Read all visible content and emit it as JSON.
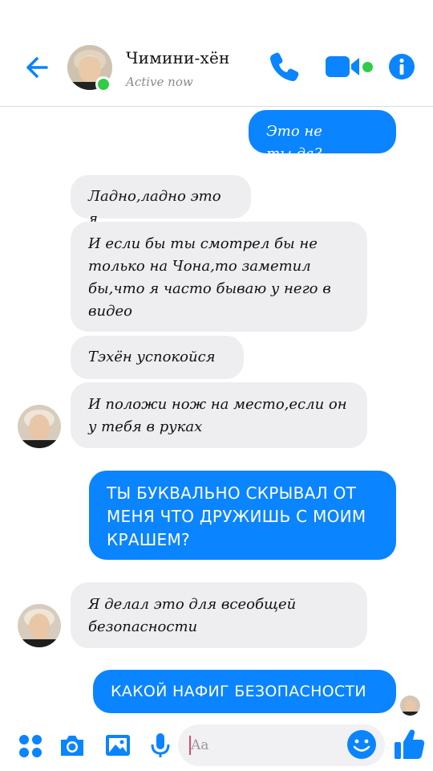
{
  "header": {
    "contact_name": "Чимини-хён",
    "status": "Active now"
  },
  "messages": [
    {
      "side": "out",
      "text": "Это не ты,да?"
    },
    {
      "side": "in",
      "text": "Ладно,ладно это я"
    },
    {
      "side": "in",
      "text": "И если бы ты смотрел бы не только на Чона,то заметил бы,что я часто бываю у него в видео"
    },
    {
      "side": "in",
      "text": "Тэхён успокойся"
    },
    {
      "side": "in",
      "text": "И положи нож на место,если он у тебя в руках"
    },
    {
      "side": "out",
      "text": "ТЫ БУКВАЛЬНО СКРЫВАЛ ОТ МЕНЯ ЧТО ДРУЖИШЬ С МОИМ КРАШЕМ?"
    },
    {
      "side": "in",
      "text": "Я делал это для всеобщей безопасности"
    },
    {
      "side": "out",
      "text": "КАКОЙ НАФИГ БЕЗОПАСНОСТИ"
    }
  ],
  "composer": {
    "placeholder": "Aa",
    "value": ""
  },
  "colors": {
    "accent": "#0a84ff",
    "online": "#31cc46",
    "incoming_bubble": "#eeeef0"
  },
  "icons": {
    "back": "arrow-left-icon",
    "call": "phone-icon",
    "video": "video-camera-icon",
    "info": "info-icon",
    "more": "four-dots-icon",
    "camera": "camera-icon",
    "image": "image-icon",
    "mic": "microphone-icon",
    "emoji": "smiley-icon",
    "like": "thumbs-up-icon"
  }
}
